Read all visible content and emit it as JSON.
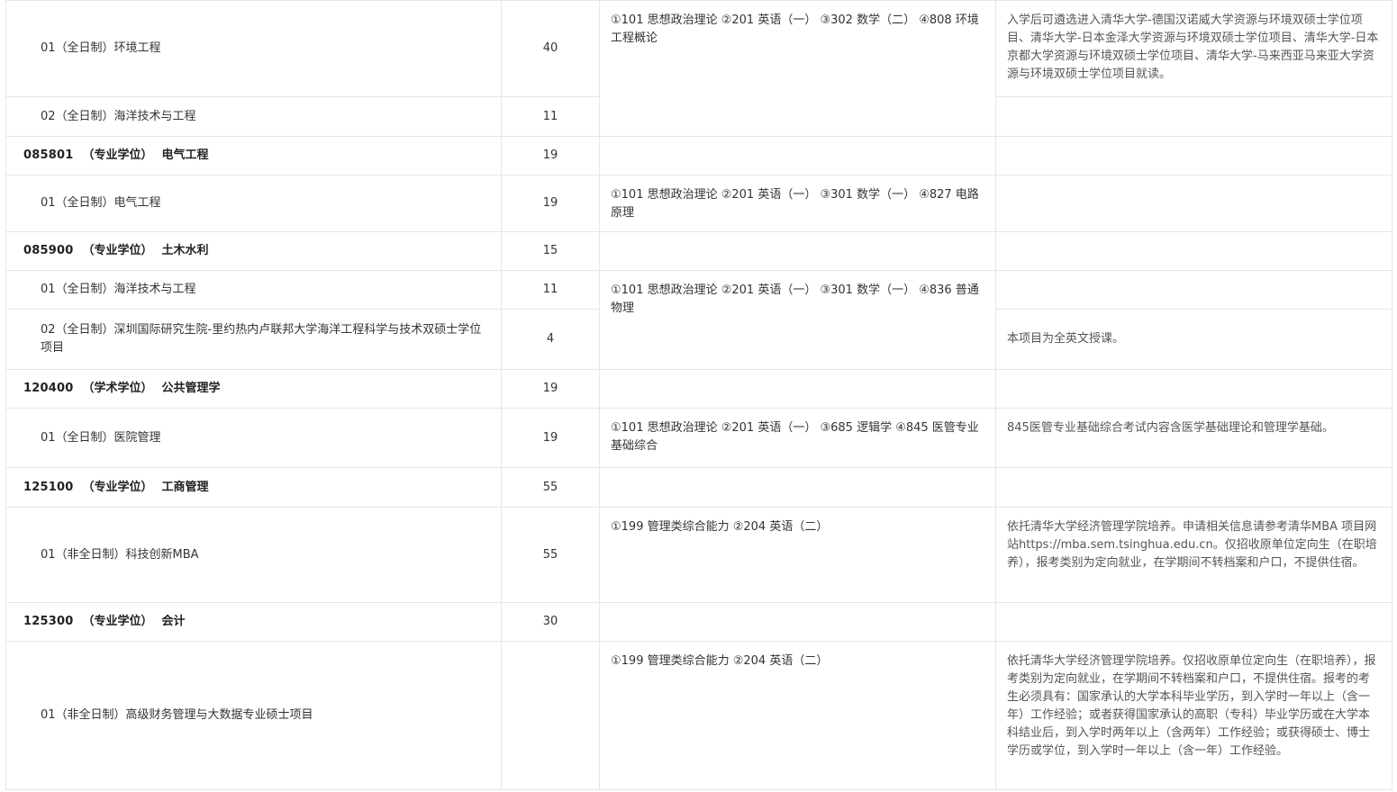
{
  "rows": [
    {
      "kind": "dir",
      "name": "01（全日制）环境工程",
      "quota": "40"
    },
    {
      "kind": "dir",
      "name": "02（全日制）海洋技术与工程",
      "quota": "11"
    },
    {
      "kind": "major",
      "code": "085801",
      "type": "（专业学位）",
      "title": "电气工程",
      "quota": "19"
    },
    {
      "kind": "dir",
      "name": "01（全日制）电气工程",
      "quota": "19"
    },
    {
      "kind": "major",
      "code": "085900",
      "type": "（专业学位）",
      "title": "土木水利",
      "quota": "15"
    },
    {
      "kind": "dir",
      "name": "01（全日制）海洋技术与工程",
      "quota": "11"
    },
    {
      "kind": "dir",
      "name": "02（全日制）深圳国际研究生院-里约热内卢联邦大学海洋工程科学与技术双硕士学位项目",
      "quota": "4"
    },
    {
      "kind": "major",
      "code": "120400",
      "type": "（学术学位）",
      "title": "公共管理学",
      "quota": "19"
    },
    {
      "kind": "dir",
      "name": "01（全日制）医院管理",
      "quota": "19"
    },
    {
      "kind": "major",
      "code": "125100",
      "type": "（专业学位）",
      "title": "工商管理",
      "quota": "55"
    },
    {
      "kind": "dir",
      "name": "01（非全日制）科技创新MBA",
      "quota": "55"
    },
    {
      "kind": "major",
      "code": "125300",
      "type": "（专业学位）",
      "title": "会计",
      "quota": "30"
    },
    {
      "kind": "dir",
      "name": "01（非全日制）高级财务管理与大数据专业硕士项目",
      "quota": ""
    }
  ],
  "subjects": {
    "env": "①101 思想政治理论 ②201 英语（一） ③302 数学（二） ④808 环境工程概论",
    "elec": "①101 思想政治理论 ②201 英语（一） ③301 数学（一） ④827 电路原理",
    "civil": "①101 思想政治理论 ②201 英语（一） ③301 数学（一） ④836 普通物理",
    "hosp": "①101 思想政治理论 ②201 英语（一） ③685 逻辑学 ④845 医管专业基础综合",
    "mba": "①199 管理类综合能力 ②204 英语（二）",
    "acct": "①199 管理类综合能力 ②204 英语（二）"
  },
  "notes": {
    "env": "入学后可遴选进入清华大学-德国汉诺威大学资源与环境双硕士学位项目、清华大学-日本金泽大学资源与环境双硕士学位项目、清华大学-日本京都大学资源与环境双硕士学位项目、清华大学-马来西亚马来亚大学资源与环境双硕士学位项目就读。",
    "ocean": "本项目为全英文授课。",
    "hosp": "845医管专业基础综合考试内容含医学基础理论和管理学基础。",
    "mba": "依托清华大学经济管理学院培养。申请相关信息请参考清华MBA 项目网站https://mba.sem.tsinghua.edu.cn。仅招收原单位定向生（在职培养），报考类别为定向就业，在学期间不转档案和户口，不提供住宿。",
    "acct": "依托清华大学经济管理学院培养。仅招收原单位定向生（在职培养），报考类别为定向就业，在学期间不转档案和户口，不提供住宿。报考的考生必须具有：国家承认的大学本科毕业学历，到入学时一年以上（含一年）工作经验；或者获得国家承认的高职（专科）毕业学历或在大学本科结业后，到入学时两年以上（含两年）工作经验；或获得硕士、博士学历或学位，到入学时一年以上（含一年）工作经验。"
  }
}
